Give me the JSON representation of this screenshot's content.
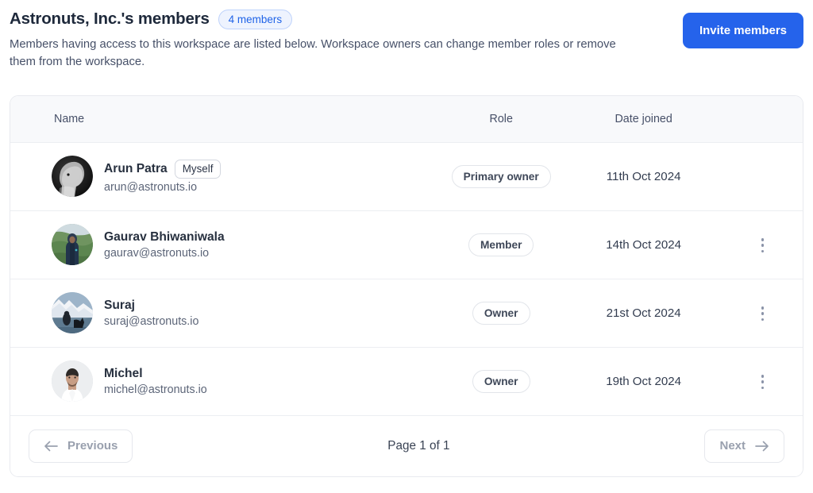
{
  "header": {
    "title": "Astronuts, Inc.'s members",
    "count_badge": "4 members",
    "description": "Members having access to this workspace are listed below. Workspace owners can change member roles or remove them from the workspace.",
    "invite_button": "Invite members"
  },
  "table": {
    "columns": {
      "name": "Name",
      "role": "Role",
      "date": "Date joined"
    },
    "rows": [
      {
        "name": "Arun Patra",
        "email": "arun@astronuts.io",
        "self_badge": "Myself",
        "role": "Primary owner",
        "date": "11th Oct 2024",
        "has_menu": false,
        "avatar": "arun-avatar"
      },
      {
        "name": "Gaurav Bhiwaniwala",
        "email": "gaurav@astronuts.io",
        "self_badge": "",
        "role": "Member",
        "date": "14th Oct 2024",
        "has_menu": true,
        "avatar": "gaurav-avatar"
      },
      {
        "name": "Suraj",
        "email": "suraj@astronuts.io",
        "self_badge": "",
        "role": "Owner",
        "date": "21st Oct 2024",
        "has_menu": true,
        "avatar": "suraj-avatar"
      },
      {
        "name": "Michel",
        "email": "michel@astronuts.io",
        "self_badge": "",
        "role": "Owner",
        "date": "19th Oct 2024",
        "has_menu": true,
        "avatar": "michel-avatar"
      }
    ]
  },
  "pagination": {
    "previous_label": "Previous",
    "page_info": "Page 1 of 1",
    "next_label": "Next"
  },
  "colors": {
    "accent": "#2563eb",
    "badge_bg": "#eef3fe",
    "badge_text": "#1f63e8",
    "header_bg": "#f8f9fb",
    "border": "#e8eaef",
    "text_primary": "#27303f",
    "text_muted": "#5c6578",
    "disabled_text": "#99a0ae"
  }
}
